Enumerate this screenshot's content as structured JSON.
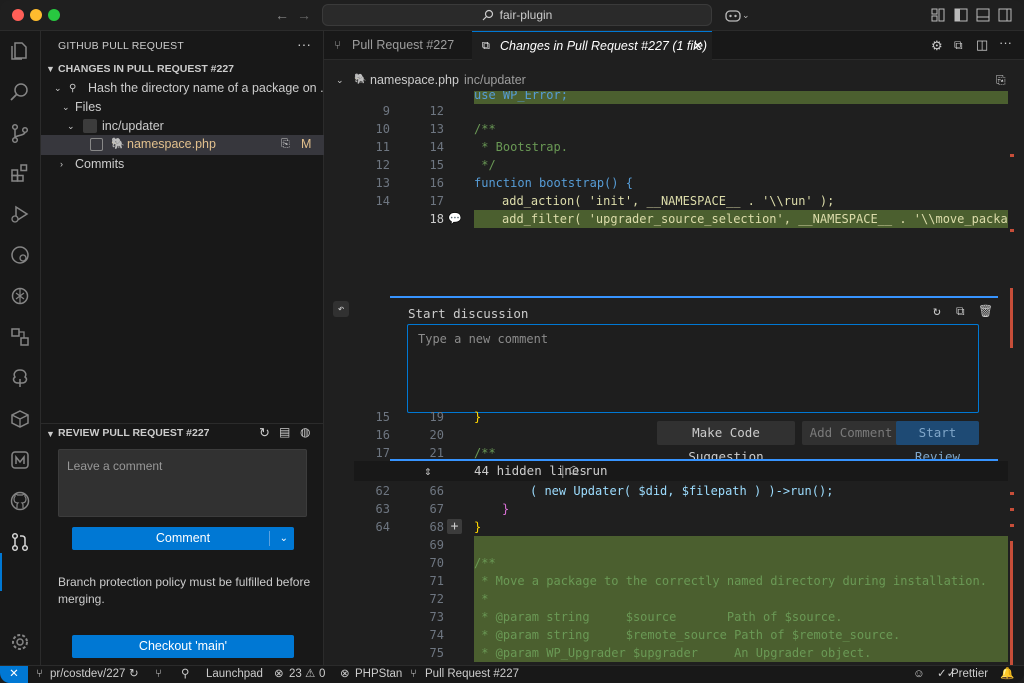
{
  "titlebar": {
    "command_center": "fair-plugin",
    "back": "←",
    "forward": "→"
  },
  "sidebar": {
    "title": "GITHUB PULL REQUEST",
    "changes_header": "CHANGES IN PULL REQUEST #227",
    "commit_message": "Hash the directory name of a package on ...",
    "files_label": "Files",
    "folder_label": "inc/updater",
    "file_label": "namespace.php",
    "file_status": "M",
    "commits_label": "Commits",
    "review_header": "REVIEW PULL REQUEST #227",
    "comment_placeholder": "Leave a comment",
    "comment_button": "Comment",
    "policy_text": "Branch protection policy must be fulfilled before merging.",
    "checkout_button": "Checkout 'main'"
  },
  "tabs": [
    {
      "label": "Pull Request #227"
    },
    {
      "label": "Changes in Pull Request #227 (1 file)"
    }
  ],
  "breadcrumbs": {
    "file": "namespace.php",
    "path": "inc/updater"
  },
  "code": {
    "top_lines": [
      {
        "old": "9",
        "new": "12"
      },
      {
        "old": "10",
        "new": "13"
      },
      {
        "old": "11",
        "new": "14"
      },
      {
        "old": "12",
        "new": "15"
      },
      {
        "old": "13",
        "new": "16"
      },
      {
        "old": "14",
        "new": "17"
      },
      {
        "old": "",
        "new": "18"
      }
    ],
    "line_use": "use WP_Error;",
    "line_comment_open": "/**",
    "line_bootstrap": " * Bootstrap.",
    "line_comment_close": " */",
    "line_function": "function bootstrap() {",
    "line_add_action": "add_action( 'init', __NAMESPACE__ . '\\\\run' );",
    "line_add_filter": "add_filter( 'upgrader_source_selection', __NAMESPACE__ . '\\\\move_package'",
    "mid_lines": [
      {
        "old": "15",
        "new": "19"
      },
      {
        "old": "16",
        "new": "20"
      },
      {
        "old": "17",
        "new": "21"
      }
    ],
    "line_close_brace": "}",
    "hidden_lines": "44 hidden lines",
    "hidden_fn": "run",
    "bottom_lines": [
      {
        "old": "62",
        "new": "66"
      },
      {
        "old": "63",
        "new": "67"
      },
      {
        "old": "64",
        "new": "68"
      },
      {
        "old": "",
        "new": "69"
      },
      {
        "old": "",
        "new": "70"
      },
      {
        "old": "",
        "new": "71"
      },
      {
        "old": "",
        "new": "72"
      },
      {
        "old": "",
        "new": "73"
      },
      {
        "old": "",
        "new": "74"
      },
      {
        "old": "",
        "new": "75"
      }
    ],
    "line_updater": "( new Updater( $did, $filepath ) )->run();",
    "line_move_desc": " * Move a package to the correctly named directory during installation.",
    "line_star": " *",
    "line_param1": " * @param string     $source       Path of $source.",
    "line_param2": " * @param string     $remote_source Path of $remote_source.",
    "line_param3": " * @param WP_Upgrader $upgrader     An Upgrader object."
  },
  "discussion": {
    "title": "Start discussion",
    "placeholder": "Type a new comment",
    "suggest_button": "Make Code Suggestion",
    "add_button": "Add Comment",
    "review_button": "Start Review"
  },
  "statusbar": {
    "branch": "pr/costdev/227",
    "launchpad": "Launchpad",
    "errors": "23",
    "warnings": "0",
    "phpstan": "PHPStan",
    "pr": "Pull Request #227",
    "prettier": "Prettier"
  },
  "colors": {
    "accent": "#0078d4",
    "added_line": "#4b5f2f"
  }
}
